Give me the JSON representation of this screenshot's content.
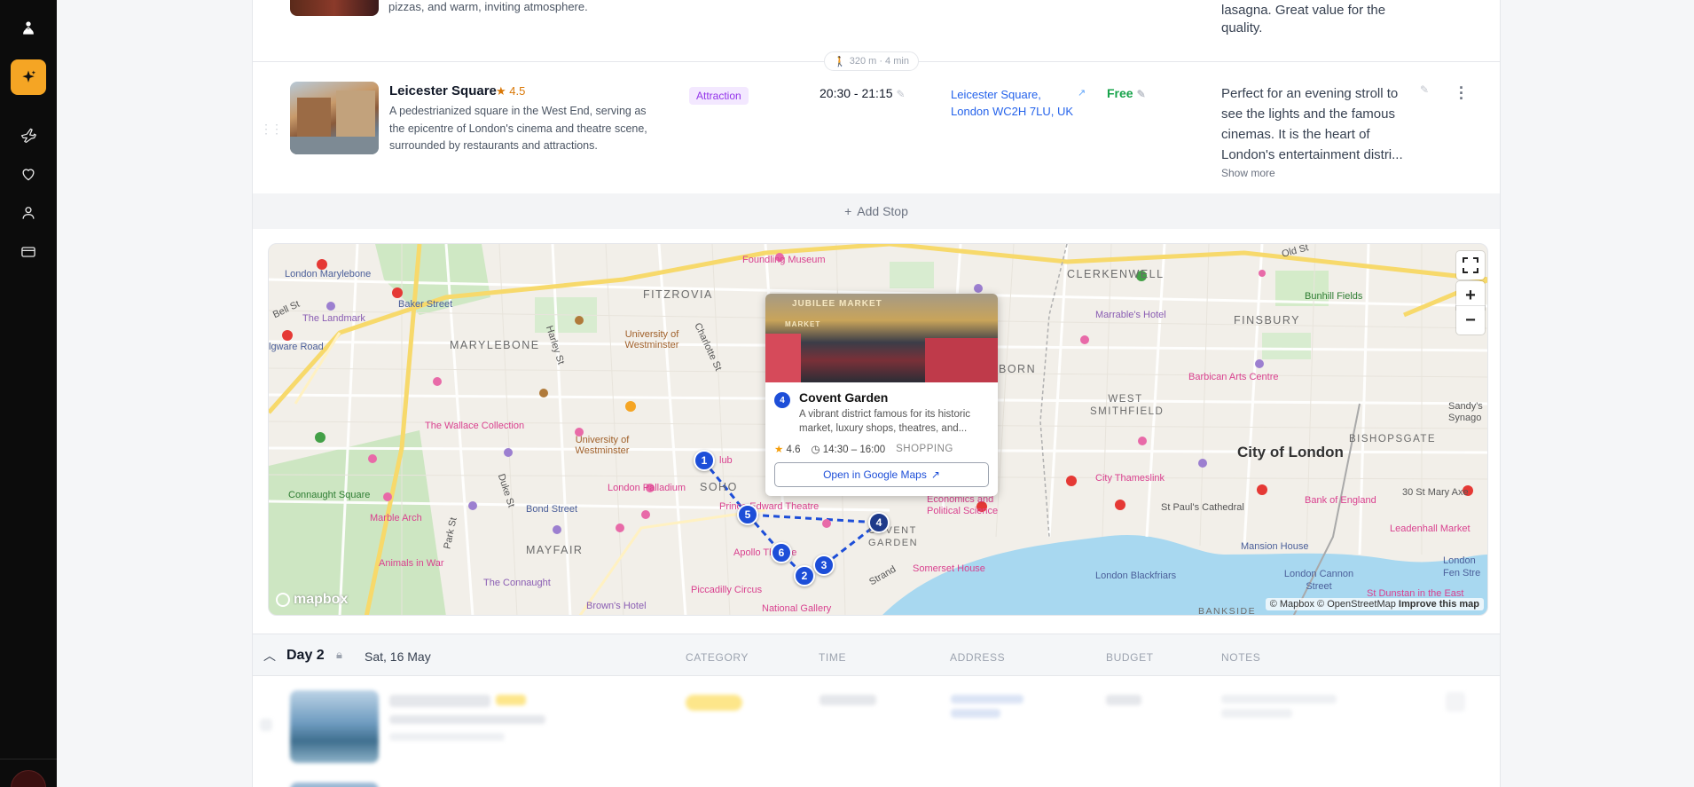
{
  "sidebar": {
    "items": [
      {
        "icon": "user-logo-icon"
      },
      {
        "icon": "sparkle-icon",
        "active": true
      },
      {
        "icon": "plane-icon"
      },
      {
        "icon": "heart-icon"
      },
      {
        "icon": "person-icon"
      },
      {
        "icon": "credit-card-icon"
      }
    ]
  },
  "previous_stop": {
    "description_tail": "pizzas, and warm, inviting atmosphere.",
    "notes_tail_1": "lasagna. Great value for the",
    "notes_tail_2": "quality."
  },
  "walk_info": "320 m · 4 min",
  "stop": {
    "name": "Leicester Square",
    "rating": "★ 4.5",
    "description": "A pedestrianized square in the West End, serving as the epicentre of London's cinema and theatre scene, surrounded by restaurants and attractions.",
    "category": "Attraction",
    "time": "20:30 - 21:15",
    "address_line1": "Leicester Square,",
    "address_line2": "London WC2H 7LU, UK",
    "budget": "Free",
    "notes": "Perfect for an evening stroll to see the lights and the famous cinemas. It is the heart of London's entertainment distri...",
    "show_more": "Show more"
  },
  "add_stop_label": "Add Stop",
  "map": {
    "labels": {
      "london_marylebone": "London Marylebone",
      "baker_street": "Baker Street",
      "the_landmark": "The Landmark",
      "bell_st": "Bell St",
      "edgware_road": "lgware Road",
      "marylebone": "MARYLEBONE",
      "fitzrovia": "FITZROVIA",
      "harley_st": "Harley St",
      "univ_westminster_1": "University of Westminster",
      "charlotte_st": "Charlotte St",
      "foundling_museum": "Foundling Museum",
      "clerkenwell": "CLERKENWELL",
      "old_st": "Old St",
      "bunhill_fields": "Bunhill Fields",
      "marrables_hotel": "Marrable's Hotel",
      "finsbury": "FINSBURY",
      "barbican": "Barbican Arts Centre",
      "born": "BORN",
      "west_smithfield": "WEST SMITHFIELD",
      "city_of_london": "City of London",
      "bishopsgate": "BISHOPSGATE",
      "sandys": "Sandy's Synago",
      "wallace": "The Wallace Collection",
      "univ_westminster_2": "University of Westminster",
      "connaught_square": "Connaught Square",
      "duke_st": "Duke St",
      "london_palladium": "London Palladium",
      "soho": "SOHO",
      "bond_street": "Bond Street",
      "marble_arch": "Marble Arch",
      "park_st": "Park St",
      "mayfair": "MAYFAIR",
      "animals_in_war": "Animals in War",
      "the_connaught": "The Connaught",
      "browns_hotel": "Brown's Hotel",
      "prince_edward": "Prince Edward Theatre",
      "apollo": "Apollo Theatre",
      "piccadilly": "Piccadilly Circus",
      "national_gallery": "National Gallery",
      "covent_garden_lbl": "COVENT GARDEN",
      "strand": "Strand",
      "somerset_house": "Somerset House",
      "lse": "Economics and Political Science",
      "city_thameslink": "City Thameslink",
      "st_pauls": "St Paul's Cathedral",
      "bank_of_england": "Bank of England",
      "leadenhall": "Leadenhall Market",
      "thirty_st_mary_axe": "30 St Mary Axe",
      "mansion_house": "Mansion House",
      "blackfriars": "London Blackfriars",
      "cannon_street": "London Cannon Street",
      "london_fen": "London Fen Stre",
      "st_dunstan": "St Dunstan in the East",
      "bankside": "BANKSIDE",
      "club": "lub"
    },
    "markers": [
      "1",
      "2",
      "3",
      "4",
      "5",
      "6"
    ],
    "popup": {
      "number": "4",
      "title": "Covent Garden",
      "description": "A vibrant district famous for its historic market, luxury shops, theatres, and...",
      "rating": "4.6",
      "time": "14:30 – 16:00",
      "category": "SHOPPING",
      "button": "Open in Google Maps",
      "image_sign": "JUBILEE MARKET",
      "image_sign_2": "MARKET"
    },
    "zoom_in": "+",
    "zoom_out": "−",
    "mapbox_logo": "mapbox",
    "attribution_1": "© Mapbox © OpenStreetMap",
    "attribution_2": "Improve this map"
  },
  "day2": {
    "title": "Day 2",
    "date": "Sat, 16 May",
    "columns": [
      "CATEGORY",
      "TIME",
      "ADDRESS",
      "BUDGET",
      "NOTES"
    ]
  },
  "colors": {
    "accent": "#f5a524",
    "route_blue": "#1d4ed8",
    "link_blue": "#2563eb",
    "budget_green": "#16a34a",
    "category_purple": "#9333ea"
  }
}
